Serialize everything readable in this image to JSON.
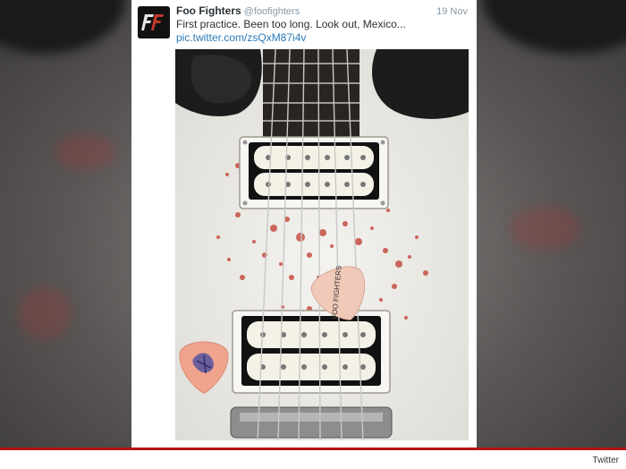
{
  "tweet": {
    "author_name": "Foo Fighters",
    "author_handle": "@foofighters",
    "date": "19 Nov",
    "text": "First practice. Been too long. Look out, Mexico...",
    "link": "pic.twitter.com/zsQxM87i4v",
    "avatar_monogram": "FF"
  },
  "photo": {
    "pick_label": "FOO FIGHTERS",
    "colors": {
      "guitar_body": "#f2f1ed",
      "fretboard": "#2a2422",
      "blood": "#c0392b",
      "pickup_bobbin": "#f4f1e6"
    }
  },
  "footer": {
    "credit": "Twitter"
  },
  "colors": {
    "accent_bar": "#b51414",
    "link": "#2b7bb9",
    "muted": "#8899a6"
  }
}
